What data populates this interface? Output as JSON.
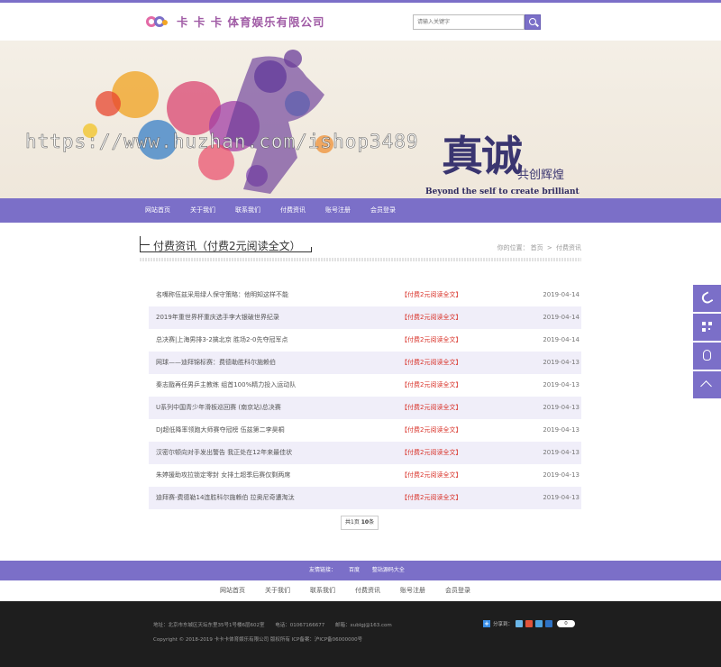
{
  "header": {
    "company_name": "卡 卡 卡 体育娱乐有限公司",
    "search_placeholder": "请输入关键字"
  },
  "banner": {
    "watermark": "https://www.huzhan.com/ishop3489",
    "slogan_main": "真诚",
    "slogan_sub": "共创辉煌",
    "slogan_en": "Beyond the self to create brilliant"
  },
  "nav": {
    "items": [
      "网站首页",
      "关于我们",
      "联系我们",
      "付费资讯",
      "账号注册",
      "会员登录"
    ]
  },
  "page": {
    "title": "付费资讯（付费2元阅读全文）",
    "breadcrumb_prefix": "你的位置：",
    "breadcrumb_home": "首页",
    "breadcrumb_sep": ">",
    "breadcrumb_current": "付费资讯"
  },
  "articles": [
    {
      "title": "名嘴称伍兹采用绿人保守策略：他明知这样不能",
      "tag": "【付费2元阅读全文】",
      "date": "2019-04-14"
    },
    {
      "title": "2019年重世界杯重庆选手李大银破世界纪录",
      "tag": "【付费2元阅读全文】",
      "date": "2019-04-14"
    },
    {
      "title": "总决赛|上海男排3-2擒北京 胜场2-0先夺冠军点",
      "tag": "【付费2元阅读全文】",
      "date": "2019-04-14"
    },
    {
      "title": "网球——迪拜锦标赛：费德勒胜科尔施赖伯",
      "tag": "【付费2元阅读全文】",
      "date": "2019-04-13"
    },
    {
      "title": "秦志戬再任男乒主教练 组首100%精力投入运动队",
      "tag": "【付费2元阅读全文】",
      "date": "2019-04-13"
    },
    {
      "title": "U系列中国青少年滑板巡回赛 (南京站)总决赛",
      "tag": "【付费2元阅读全文】",
      "date": "2019-04-13"
    },
    {
      "title": "DJ超低降率领跑大师赛夺冠榜 伍兹第二李昊桐",
      "tag": "【付费2元阅读全文】",
      "date": "2019-04-13"
    },
    {
      "title": "汉密尔顿向对手发出警告 我正处在12年来最佳状",
      "tag": "【付费2元阅读全文】",
      "date": "2019-04-13"
    },
    {
      "title": "朱婷援助攻拉锁定零封 女排土超季后赛仅剩两席",
      "tag": "【付费2元阅读全文】",
      "date": "2019-04-13"
    },
    {
      "title": "迪拜赛-费德勒14连胜科尔施赖伯 拉奥尼奇遭淘汰",
      "tag": "【付费2元阅读全文】",
      "date": "2019-04-13"
    }
  ],
  "pager": {
    "prefix": "共1页 ",
    "count": "10",
    "suffix": "条"
  },
  "friend_links": {
    "label": "友情链接：",
    "items": [
      "百度",
      "整站源码大全"
    ]
  },
  "footer_nav": {
    "items": [
      "网站首页",
      "关于我们",
      "联系我们",
      "付费资讯",
      "账号注册",
      "会员登录"
    ]
  },
  "footer": {
    "address": "地址：北京市东城区天坛东里35号1号楼6层602室",
    "phone": "电话：01067166677",
    "email": "邮箱：xublgj@163.com",
    "copyright": "Copyright © 2018-2019 卡卡卡体育娱乐有限公司 版权所有  ICP备案：沪ICP备06000000号",
    "share_label": "分享到：",
    "share_count": "0"
  },
  "colors": {
    "accent": "#7b6fc8",
    "tag_red": "#d9342b",
    "footer_bg": "#1e1e1e"
  },
  "icons": [
    "search-icon",
    "phone-icon",
    "qrcode-icon",
    "qq-icon",
    "back-to-top-icon"
  ]
}
